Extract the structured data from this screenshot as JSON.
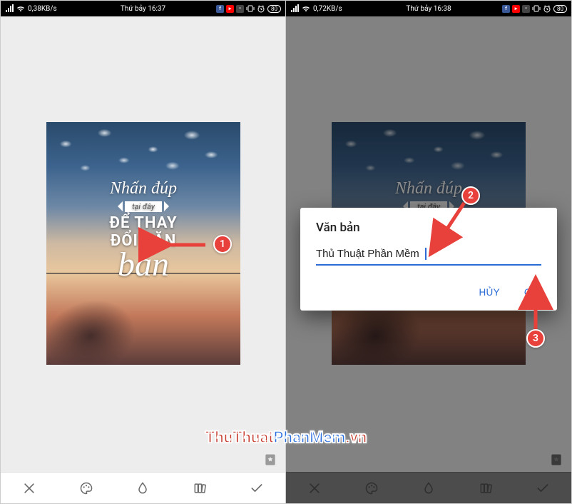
{
  "status": {
    "left_speed": "0,38KB/s",
    "left_time": "Thứ bảy 16:37",
    "right_speed": "0,72KB/s",
    "right_time": "Thứ bảy 16:38",
    "battery": "80"
  },
  "photo_caption": {
    "line1": "Nhấn đúp",
    "ribbon": "tại đây",
    "line2a": "ĐỂ THAY",
    "line2b": "ĐỔI VĂN",
    "line3": "bản"
  },
  "dialog": {
    "title": "Văn bản",
    "input_value": "Thủ Thuật Phần Mềm",
    "cancel": "HỦY",
    "ok": "OK"
  },
  "annotations": {
    "b1": "1",
    "b2": "2",
    "b3": "3"
  },
  "watermark": {
    "part1": "ThuThuat",
    "part2": "PhanMem",
    "part3": ".vn"
  },
  "toolbar_icons": [
    "close-icon",
    "palette-icon",
    "drop-icon",
    "library-icon",
    "check-icon"
  ]
}
